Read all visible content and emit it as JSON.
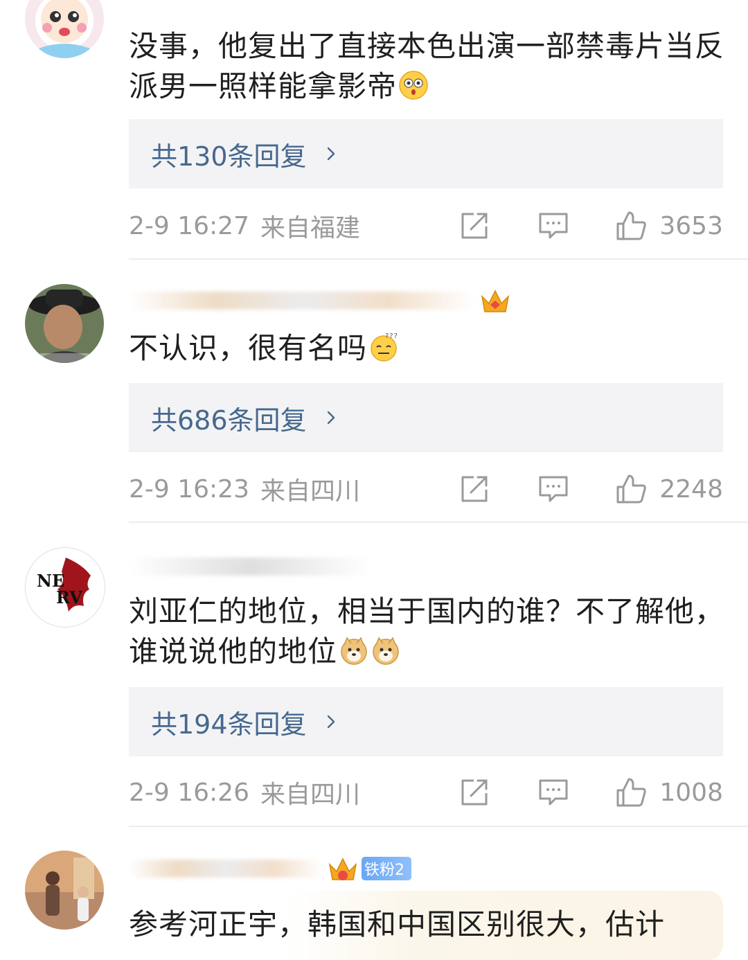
{
  "comments": [
    {
      "text": "没事，他复出了直接本色出演一部禁毒片当反派男一照样能拿影帝",
      "emoji": "flushed-face-emoji",
      "replies_label": "共130条回复",
      "time": "2-9 16:27",
      "location": "来自福建",
      "likes": "3653"
    },
    {
      "text": "不认识，很有名吗",
      "emoji": "confused-face-emoji",
      "replies_label": "共686条回复",
      "time": "2-9 16:23",
      "location": "来自四川",
      "likes": "2248"
    },
    {
      "text": "刘亚仁的地位，相当于国内的谁？不了解他，谁说说他的地位",
      "emoji": "doge-emoji",
      "replies_label": "共194条回复",
      "time": "2-9 16:26",
      "location": "来自四川",
      "likes": "1008"
    },
    {
      "text": "参考河正宇，韩国和中国区别很大，估计",
      "badge_label": "铁粉2"
    }
  ],
  "icons": {
    "share": "share-icon",
    "comment": "comment-icon",
    "like": "thumbs-up-icon",
    "chevron": "chevron-right-icon",
    "crown": "crown-icon"
  },
  "colors": {
    "reply_link": "#46688f",
    "meta_text": "#9a9a9a",
    "reply_bg": "#f3f3f5",
    "badge": "#6aa7f5"
  }
}
